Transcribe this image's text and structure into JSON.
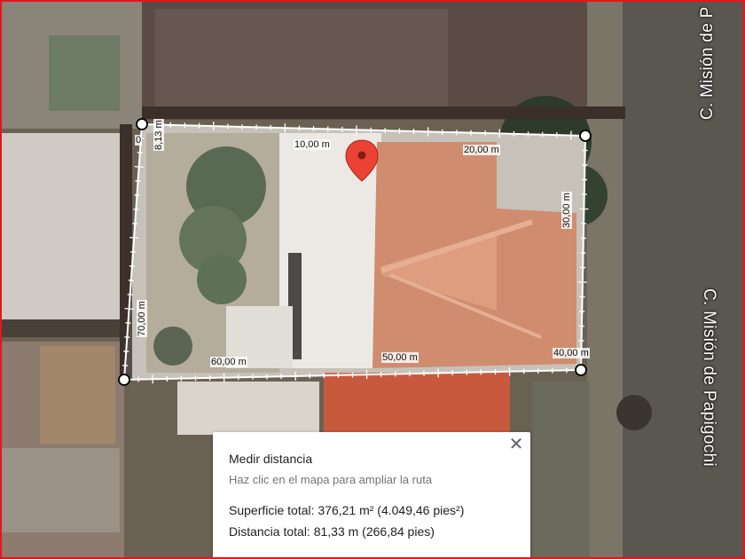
{
  "map": {
    "streets": [
      {
        "name": "C. Misión de P"
      },
      {
        "name": "C. Misión de Papigochi"
      }
    ],
    "measure_segments": [
      {
        "label": "8,13 m"
      },
      {
        "label": "10,00 m"
      },
      {
        "label": "20,00 m"
      },
      {
        "label": "30,00 m"
      },
      {
        "label": "40,00 m"
      },
      {
        "label": "50,00 m"
      },
      {
        "label": "60,00 m"
      },
      {
        "label": "70,00 m"
      },
      {
        "label": "0"
      }
    ],
    "pin_icon": "location-pin-icon",
    "accent_color": "#e8141c",
    "pin_color": "#ea4335"
  },
  "measure_panel": {
    "title": "Medir distancia",
    "hint": "Haz clic en el mapa para ampliar la ruta",
    "area": "Superficie total: 376,21 m² (4.049,46 pies²)",
    "distance": "Distancia total: 81,33 m (266,84 pies)",
    "close_icon": "close-icon",
    "close_symbol": "✕"
  }
}
